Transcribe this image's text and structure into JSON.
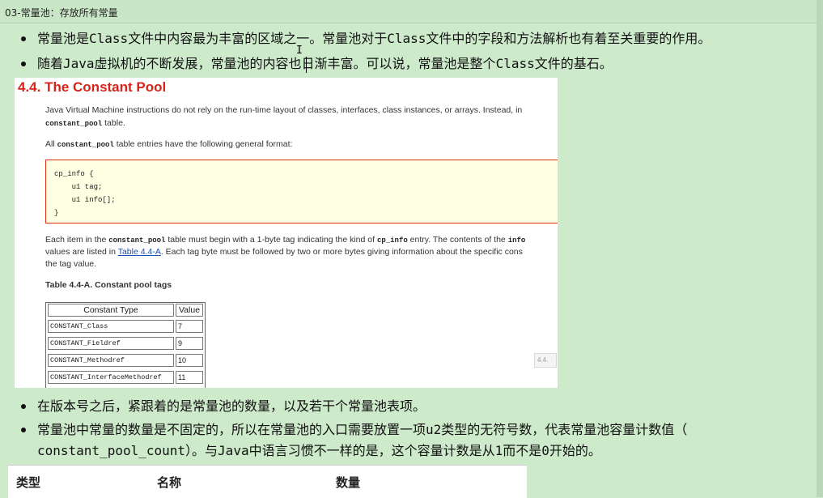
{
  "window": {
    "title": "03-常量池：存放所有常量"
  },
  "bullets": [
    {
      "parts": [
        {
          "t": "常量池是",
          "mono": false
        },
        {
          "t": "Class",
          "mono": true
        },
        {
          "t": "文件中内容最为丰富的区域之一。常量池对于",
          "mono": false
        },
        {
          "t": "Class",
          "mono": true
        },
        {
          "t": "文件中的字段和方法解析也有着至关重要的作用。",
          "mono": false
        }
      ]
    },
    {
      "parts": [
        {
          "t": "随着",
          "mono": false
        },
        {
          "t": "Java",
          "mono": true
        },
        {
          "t": "虚拟机的不断发展，常量池的内容也日渐丰富。可以说，常量池是整个",
          "mono": false
        },
        {
          "t": "Class",
          "mono": true
        },
        {
          "t": "文件的基石。",
          "mono": false
        }
      ]
    },
    {
      "parts": [
        {
          "t": "在版本号之后，紧跟着的是常量池的数量，以及若干个常量池表项。",
          "mono": false
        }
      ]
    },
    {
      "line1": [
        {
          "t": "常量池中常量的数量是不固定的，所以在常量池的入口需要放置一项",
          "mono": false
        },
        {
          "t": "u2",
          "mono": true
        },
        {
          "t": "类型的无符号数，代表常量池容量计数值（",
          "mono": false
        }
      ],
      "line2": [
        {
          "t": "constant_pool_count",
          "mono": true
        },
        {
          "t": "）。与",
          "mono": false
        },
        {
          "t": "Java",
          "mono": true
        },
        {
          "t": "中语言习惯不一样的是，这个容量计数是从",
          "mono": false
        },
        {
          "t": "1",
          "mono": true
        },
        {
          "t": "而不是",
          "mono": false
        },
        {
          "t": "0",
          "mono": true
        },
        {
          "t": "开始的。",
          "mono": false
        }
      ]
    }
  ],
  "doc": {
    "heading": "4.4. The Constant Pool",
    "p1_line1": "Java Virtual Machine instructions do not rely on the run-time layout of classes, interfaces, class instances, or arrays. Instead, in",
    "p1_line2_code": "constant_pool",
    "p1_line2_rest": " table.",
    "p2_pre": "All ",
    "p2_code": "constant_pool",
    "p2_post": " table entries have the following general format:",
    "code_lines": [
      "cp_info {",
      "    u1 tag;",
      "    u1 info[];",
      "}"
    ],
    "p3_l1_a": "Each item in the ",
    "p3_l1_code1": "constant_pool",
    "p3_l1_b": " table must begin with a 1-byte tag indicating the kind of ",
    "p3_l1_code2": "cp_info",
    "p3_l1_c": " entry. The contents of the ",
    "p3_l1_code3": "info",
    "p3_l2_a": "values are listed in ",
    "p3_l2_link": "Table 4.4-A",
    "p3_l2_b": ". Each tag byte must be followed by two or more bytes giving information about the specific cons",
    "p3_l3": "the tag value.",
    "table_caption": "Table 4.4-A. Constant pool tags",
    "table_headers": [
      "Constant Type",
      "Value"
    ],
    "table_rows": [
      [
        "CONSTANT_Class",
        "7"
      ],
      [
        "CONSTANT_Fieldref",
        "9"
      ],
      [
        "CONSTANT_Methodref",
        "10"
      ],
      [
        "CONSTANT_InterfaceMethodref",
        "11"
      ]
    ],
    "popup_text": "4.4."
  },
  "bottom_table": {
    "headers": [
      "类型",
      "名称",
      "数量"
    ]
  }
}
